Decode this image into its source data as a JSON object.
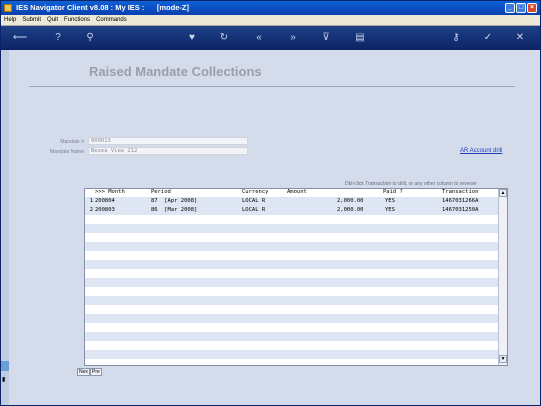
{
  "window": {
    "title": "IES Navigator Client v8.08 : My IES :      [mode-Z]"
  },
  "menu": [
    "Help",
    "Submit",
    "Quit",
    "Functions",
    "Commands"
  ],
  "toolbar": {
    "icons": [
      "exit-icon",
      "help-icon",
      "search-icon",
      "favorite-icon",
      "refresh-icon",
      "first-icon",
      "last-icon",
      "filter-icon",
      "clipboard-icon",
      "lock-icon",
      "confirm-icon",
      "cancel-icon"
    ]
  },
  "page": {
    "title": "Raised Mandate Collections"
  },
  "fields": {
    "mandate_no_label": "Mandate #",
    "mandate_no_value": "000013",
    "mandate_name_label": "Mandate Name",
    "mandate_name_value": "Bezea View 212"
  },
  "links": {
    "ar_account_drill": "AR Account drill"
  },
  "grid": {
    "hint": "Dbl-click Transaction to drill,  or any other column to reverse",
    "headers": {
      "month": ">>> Month",
      "period": "Period",
      "currency": "Currency",
      "amount": "Amount",
      "paid": "Paid ?",
      "transaction": "Transaction"
    },
    "rows": [
      {
        "n": "1",
        "month": "200804",
        "period": "87  [Apr 2008]",
        "currency": "LOCAL R",
        "amount": "2,000.00",
        "paid": "YES",
        "transaction": "1467031266A"
      },
      {
        "n": "2",
        "month": "200803",
        "period": "86  [Mar 2008]",
        "currency": "LOCAL R",
        "amount": "2,000.00",
        "paid": "YES",
        "transaction": "1467031250A"
      }
    ]
  },
  "nav": {
    "next": "Nex",
    "prev": "Pre"
  }
}
